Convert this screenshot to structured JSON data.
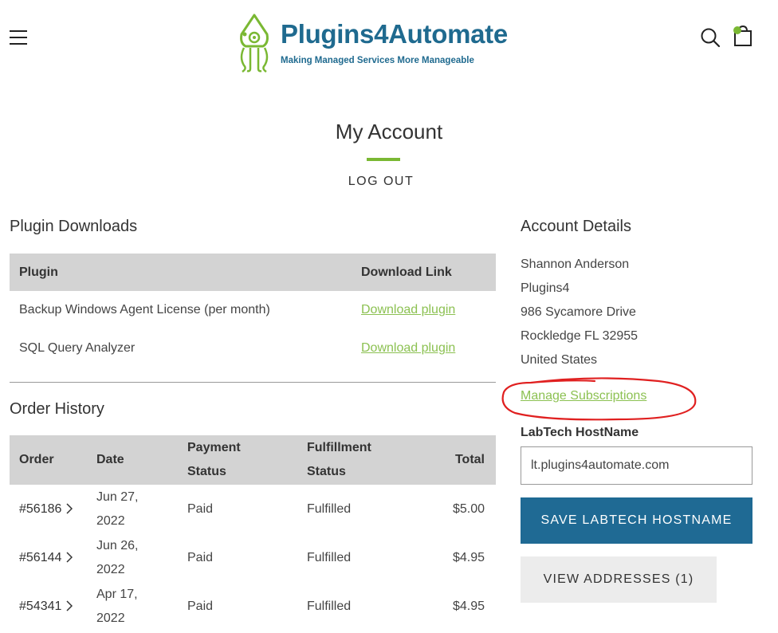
{
  "brand": {
    "name": "Plugins4Automate",
    "tagline": "Making Managed Services More Manageable",
    "accent": "#7ab833",
    "primary": "#1f6a8f"
  },
  "header": {
    "menu_icon": "hamburger-icon",
    "search_icon": "search-icon",
    "cart_icon": "shopping-bag-icon"
  },
  "page": {
    "title": "My Account",
    "logout_label": "LOG OUT"
  },
  "downloads": {
    "heading": "Plugin Downloads",
    "columns": [
      "Plugin",
      "Download Link"
    ],
    "rows": [
      {
        "plugin": "Backup Windows Agent License (per month)",
        "link": "Download plugin"
      },
      {
        "plugin": "SQL Query Analyzer",
        "link": "Download plugin"
      }
    ]
  },
  "orders": {
    "heading": "Order History",
    "columns": {
      "order": "Order",
      "date": "Date",
      "payment": "Payment Status",
      "fulfillment": "Fulfillment Status",
      "total": "Total"
    },
    "rows": [
      {
        "order": "#56186",
        "date": "Jun 27, 2022",
        "payment": "Paid",
        "fulfillment": "Fulfilled",
        "total": "$5.00"
      },
      {
        "order": "#56144",
        "date": "Jun 26, 2022",
        "payment": "Paid",
        "fulfillment": "Fulfilled",
        "total": "$4.95"
      },
      {
        "order": "#54341",
        "date": "Apr 17, 2022",
        "payment": "Paid",
        "fulfillment": "Fulfilled",
        "total": "$4.95"
      }
    ]
  },
  "account": {
    "heading": "Account Details",
    "address_lines": [
      "Shannon Anderson",
      "Plugins4",
      "986 Sycamore Drive",
      "Rockledge FL 32955",
      "United States"
    ],
    "manage_subscriptions": "Manage Subscriptions",
    "hostname_label": "LabTech HostName",
    "hostname_value": "lt.plugins4automate.com",
    "save_button": "SAVE LABTECH HOSTNAME",
    "view_addresses_button": "VIEW ADDRESSES (1)"
  }
}
